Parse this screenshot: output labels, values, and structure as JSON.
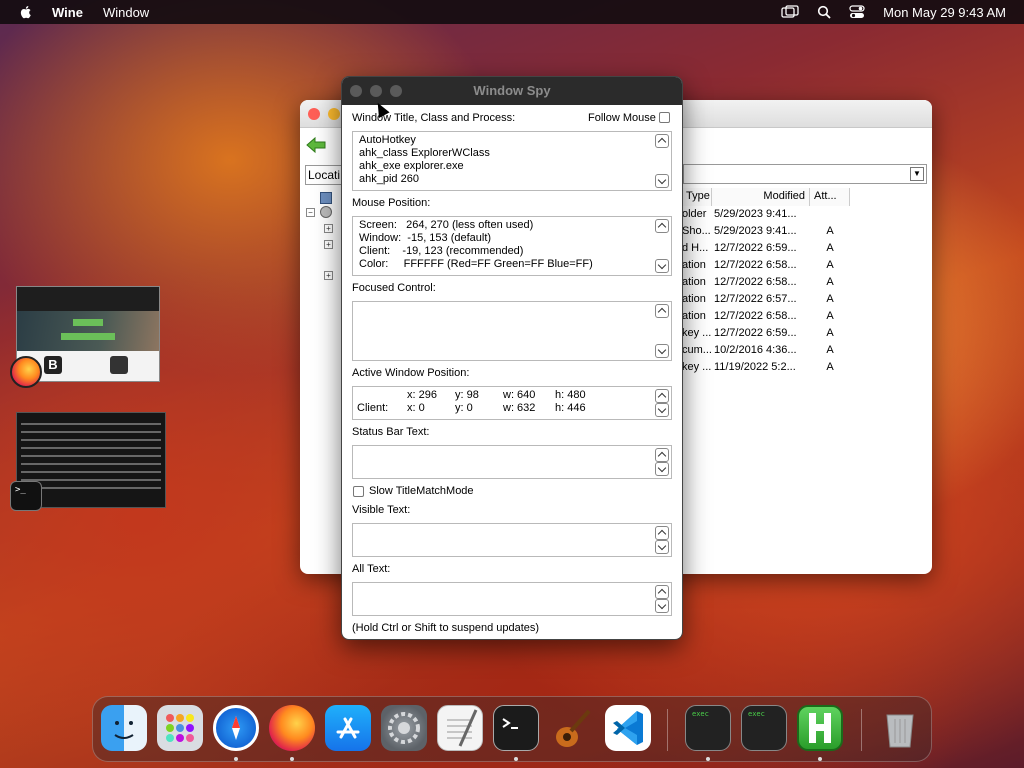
{
  "menubar": {
    "app_name": "Wine",
    "menu_window": "Window",
    "clock": "Mon May 29  9:43 AM"
  },
  "explorer": {
    "location_label": "Locati",
    "columns": [
      "Type",
      "Modified",
      "Att..."
    ],
    "rows": [
      {
        "type": "older",
        "modified": "5/29/2023 9:41...",
        "attr": ""
      },
      {
        "type": "Sho...",
        "modified": "5/29/2023 9:41...",
        "attr": "A"
      },
      {
        "type": "d H...",
        "modified": "12/7/2022 6:59...",
        "attr": "A"
      },
      {
        "type": "ation",
        "modified": "12/7/2022 6:58...",
        "attr": "A"
      },
      {
        "type": "ation",
        "modified": "12/7/2022 6:58...",
        "attr": "A"
      },
      {
        "type": "ation",
        "modified": "12/7/2022 6:57...",
        "attr": "A"
      },
      {
        "type": "ation",
        "modified": "12/7/2022 6:58...",
        "attr": "A"
      },
      {
        "type": "key ...",
        "modified": "12/7/2022 6:59...",
        "attr": "A"
      },
      {
        "type": "cum...",
        "modified": "10/2/2016 4:36...",
        "attr": "A"
      },
      {
        "type": "key ...",
        "modified": "11/19/2022 5:2...",
        "attr": "A"
      }
    ]
  },
  "spy": {
    "title": "Window Spy",
    "window_section_label": "Window Title, Class and Process:",
    "follow_mouse_label": "Follow Mouse",
    "window_info": "AutoHotkey\nahk_class ExplorerWClass\nahk_exe explorer.exe\nahk_pid 260",
    "mouse_section_label": "Mouse Position:",
    "mouse_info": "Screen:   264, 270 (less often used)\nWindow:  -15, 153 (default)\nClient:    -19, 123 (recommended)\nColor:     FFFFFF (Red=FF Green=FF Blue=FF)",
    "focused_label": "Focused Control:",
    "focused_value": "",
    "active_pos_label": "Active Window Position:",
    "active_rows": [
      {
        "label": "",
        "x": "x: 296",
        "y": "y: 98",
        "w": "w: 640",
        "h": "h: 480"
      },
      {
        "label": "Client:",
        "x": "x: 0",
        "y": "y: 0",
        "w": "w: 632",
        "h": "h: 446"
      }
    ],
    "status_bar_label": "Status Bar Text:",
    "slow_match_label": "Slow TitleMatchMode",
    "visible_text_label": "Visible Text:",
    "all_text_label": "All Text:",
    "footer_hint": "(Hold Ctrl or Shift to suspend updates)"
  },
  "thumbs": {
    "term_prompt": ">_"
  },
  "colors": {
    "menubar_bg": "#140c10",
    "spy_title_bg": "#2b2b2b",
    "explorer_close": "#ff5f57",
    "explorer_min": "#febc2e"
  },
  "dock": {
    "items": [
      "finder-icon",
      "launchpad-icon",
      "safari-icon",
      "firefox-icon",
      "app-store-icon",
      "system-settings-icon",
      "textedit-icon",
      "terminal-icon",
      "garageband-icon",
      "vscode-icon",
      "exec-icon",
      "exec-icon",
      "wine-h-icon",
      "trash-icon"
    ],
    "exec_label": "exec"
  }
}
